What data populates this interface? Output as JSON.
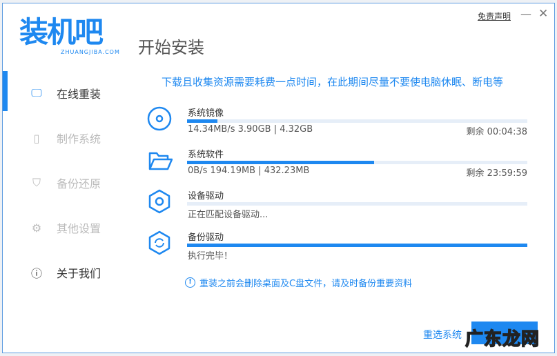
{
  "app": {
    "logo": "装机吧",
    "logo_sub": "ZHUANGJIBA.COM",
    "title": "开始安装",
    "disclaimer": "免责声明"
  },
  "sidebar": {
    "items": [
      {
        "label": "在线重装",
        "icon": "monitor-icon"
      },
      {
        "label": "制作系统",
        "icon": "usb-icon"
      },
      {
        "label": "备份还原",
        "icon": "shield-icon"
      },
      {
        "label": "其他设置",
        "icon": "gear-icon"
      },
      {
        "label": "关于我们",
        "icon": "info-icon"
      }
    ]
  },
  "main": {
    "notice": "下载且收集资源需要耗费一点时间，在此期间尽量不要使电脑休眠、断电等",
    "tasks": [
      {
        "name": "系统镜像",
        "info": "14.34MB/s 3.90GB | 4.32GB",
        "remain": "剩余 00:04:38",
        "progress": 9,
        "icon": "disc-icon"
      },
      {
        "name": "系统软件",
        "info": "0B/s 194.19MB | 432.23MB",
        "remain": "剩余 23:59:59",
        "progress": 55,
        "icon": "folder-icon"
      },
      {
        "name": "设备驱动",
        "info": "正在匹配设备驱动...",
        "remain": "",
        "progress": 0,
        "icon": "gear-icon"
      },
      {
        "name": "备份驱动",
        "info": "执行完毕！",
        "remain": "",
        "progress": 100,
        "icon": "gear-refresh-icon"
      }
    ],
    "tip": "重装之前会删除桌面及C盘文件，请及时备份重要资料",
    "reselect": "重选系统",
    "watermark": "广东龙网"
  },
  "colors": {
    "accent": "#1e88f0"
  }
}
